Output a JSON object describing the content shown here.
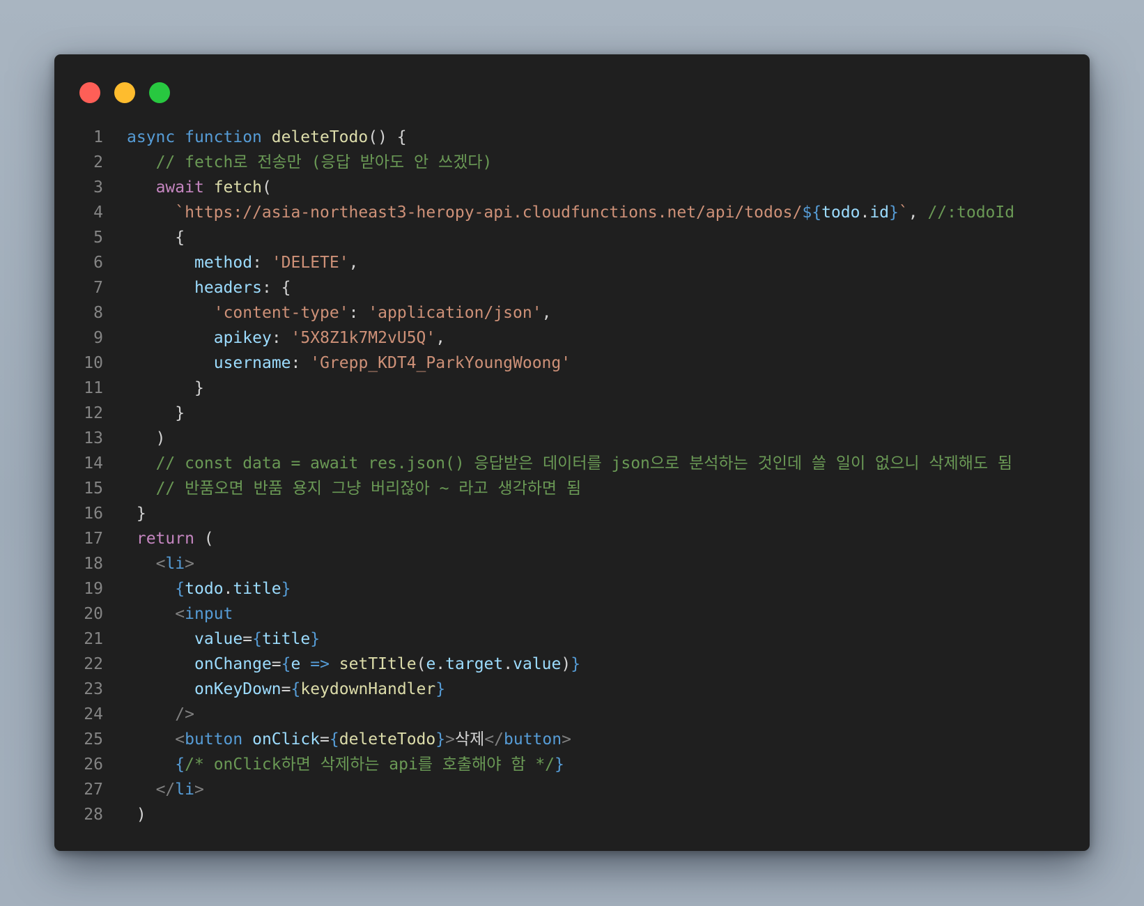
{
  "window": {
    "buttons": {
      "close": "close",
      "minimize": "minimize",
      "zoom": "zoom"
    },
    "colors": {
      "close": "#fe5f57",
      "minimize": "#febc2e",
      "zoom": "#28c840",
      "background": "#1f1f1f"
    }
  },
  "code": {
    "lines": [
      {
        "n": "1",
        "indent": 0,
        "tokens": [
          {
            "t": "async",
            "k": "kw"
          },
          {
            "t": " ",
            "k": "punc"
          },
          {
            "t": "function",
            "k": "kw"
          },
          {
            "t": " ",
            "k": "punc"
          },
          {
            "t": "deleteTodo",
            "k": "fn"
          },
          {
            "t": "() {",
            "k": "punc"
          }
        ]
      },
      {
        "n": "2",
        "indent": 3,
        "tokens": [
          {
            "t": "// fetch로 전송만 (응답 받아도 안 쓰겠다)",
            "k": "cmt"
          }
        ]
      },
      {
        "n": "3",
        "indent": 3,
        "tokens": [
          {
            "t": "await",
            "k": "ctrl"
          },
          {
            "t": " ",
            "k": "punc"
          },
          {
            "t": "fetch",
            "k": "fn"
          },
          {
            "t": "(",
            "k": "punc"
          }
        ]
      },
      {
        "n": "4",
        "indent": 5,
        "tokens": [
          {
            "t": "`https://asia-northeast3-heropy-api.cloudfunctions.net/api/todos/",
            "k": "str"
          },
          {
            "t": "${",
            "k": "kw"
          },
          {
            "t": "todo",
            "k": "var"
          },
          {
            "t": ".",
            "k": "punc"
          },
          {
            "t": "id",
            "k": "var"
          },
          {
            "t": "}",
            "k": "kw"
          },
          {
            "t": "`",
            "k": "str"
          },
          {
            "t": ", ",
            "k": "punc"
          },
          {
            "t": "//:todoId",
            "k": "cmt"
          }
        ]
      },
      {
        "n": "5",
        "indent": 5,
        "tokens": [
          {
            "t": "{",
            "k": "punc"
          }
        ]
      },
      {
        "n": "6",
        "indent": 7,
        "tokens": [
          {
            "t": "method",
            "k": "prop"
          },
          {
            "t": ": ",
            "k": "punc"
          },
          {
            "t": "'DELETE'",
            "k": "str"
          },
          {
            "t": ",",
            "k": "punc"
          }
        ]
      },
      {
        "n": "7",
        "indent": 7,
        "tokens": [
          {
            "t": "headers",
            "k": "prop"
          },
          {
            "t": ": {",
            "k": "punc"
          }
        ]
      },
      {
        "n": "8",
        "indent": 9,
        "tokens": [
          {
            "t": "'content-type'",
            "k": "str"
          },
          {
            "t": ": ",
            "k": "punc"
          },
          {
            "t": "'application/json'",
            "k": "str"
          },
          {
            "t": ",",
            "k": "punc"
          }
        ]
      },
      {
        "n": "9",
        "indent": 9,
        "tokens": [
          {
            "t": "apikey",
            "k": "prop"
          },
          {
            "t": ": ",
            "k": "punc"
          },
          {
            "t": "'5X8Z1k7M2vU5Q'",
            "k": "str"
          },
          {
            "t": ",",
            "k": "punc"
          }
        ]
      },
      {
        "n": "10",
        "indent": 9,
        "tokens": [
          {
            "t": "username",
            "k": "prop"
          },
          {
            "t": ": ",
            "k": "punc"
          },
          {
            "t": "'Grepp_KDT4_ParkYoungWoong'",
            "k": "str"
          }
        ]
      },
      {
        "n": "11",
        "indent": 7,
        "tokens": [
          {
            "t": "}",
            "k": "punc"
          }
        ]
      },
      {
        "n": "12",
        "indent": 5,
        "tokens": [
          {
            "t": "}",
            "k": "punc"
          }
        ]
      },
      {
        "n": "13",
        "indent": 3,
        "tokens": [
          {
            "t": ")",
            "k": "punc"
          }
        ]
      },
      {
        "n": "14",
        "indent": 3,
        "tokens": [
          {
            "t": "// const data = await res.json() 응답받은 데이터를 json으로 분석하는 것인데 쓸 일이 없으니 삭제해도 됨",
            "k": "cmt"
          }
        ]
      },
      {
        "n": "15",
        "indent": 3,
        "tokens": [
          {
            "t": "// 반품오면 반품 용지 그냥 버리잖아 ~ 라고 생각하면 됨",
            "k": "cmt"
          }
        ]
      },
      {
        "n": "16",
        "indent": 1,
        "tokens": [
          {
            "t": "}",
            "k": "punc"
          }
        ]
      },
      {
        "n": "17",
        "indent": 1,
        "tokens": [
          {
            "t": "return",
            "k": "ctrl"
          },
          {
            "t": " (",
            "k": "punc"
          }
        ]
      },
      {
        "n": "18",
        "indent": 3,
        "tokens": [
          {
            "t": "<",
            "k": "brk"
          },
          {
            "t": "li",
            "k": "tag"
          },
          {
            "t": ">",
            "k": "brk"
          }
        ]
      },
      {
        "n": "19",
        "indent": 5,
        "tokens": [
          {
            "t": "{",
            "k": "kw"
          },
          {
            "t": "todo",
            "k": "var"
          },
          {
            "t": ".",
            "k": "punc"
          },
          {
            "t": "title",
            "k": "var"
          },
          {
            "t": "}",
            "k": "kw"
          }
        ]
      },
      {
        "n": "20",
        "indent": 5,
        "tokens": [
          {
            "t": "<",
            "k": "brk"
          },
          {
            "t": "input",
            "k": "tag"
          }
        ]
      },
      {
        "n": "21",
        "indent": 7,
        "tokens": [
          {
            "t": "value",
            "k": "prop"
          },
          {
            "t": "=",
            "k": "punc"
          },
          {
            "t": "{",
            "k": "kw"
          },
          {
            "t": "title",
            "k": "var"
          },
          {
            "t": "}",
            "k": "kw"
          }
        ]
      },
      {
        "n": "22",
        "indent": 7,
        "tokens": [
          {
            "t": "onChange",
            "k": "prop"
          },
          {
            "t": "=",
            "k": "punc"
          },
          {
            "t": "{",
            "k": "kw"
          },
          {
            "t": "e",
            "k": "var"
          },
          {
            "t": " ",
            "k": "punc"
          },
          {
            "t": "=>",
            "k": "kw"
          },
          {
            "t": " ",
            "k": "punc"
          },
          {
            "t": "setTItle",
            "k": "fn"
          },
          {
            "t": "(",
            "k": "punc"
          },
          {
            "t": "e",
            "k": "var"
          },
          {
            "t": ".",
            "k": "punc"
          },
          {
            "t": "target",
            "k": "var"
          },
          {
            "t": ".",
            "k": "punc"
          },
          {
            "t": "value",
            "k": "var"
          },
          {
            "t": ")",
            "k": "punc"
          },
          {
            "t": "}",
            "k": "kw"
          }
        ]
      },
      {
        "n": "23",
        "indent": 7,
        "tokens": [
          {
            "t": "onKeyDown",
            "k": "prop"
          },
          {
            "t": "=",
            "k": "punc"
          },
          {
            "t": "{",
            "k": "kw"
          },
          {
            "t": "keydownHandler",
            "k": "fn"
          },
          {
            "t": "}",
            "k": "kw"
          }
        ]
      },
      {
        "n": "24",
        "indent": 5,
        "tokens": [
          {
            "t": "/>",
            "k": "brk"
          }
        ]
      },
      {
        "n": "25",
        "indent": 5,
        "tokens": [
          {
            "t": "<",
            "k": "brk"
          },
          {
            "t": "button",
            "k": "tag"
          },
          {
            "t": " ",
            "k": "punc"
          },
          {
            "t": "onClick",
            "k": "prop"
          },
          {
            "t": "=",
            "k": "punc"
          },
          {
            "t": "{",
            "k": "kw"
          },
          {
            "t": "deleteTodo",
            "k": "fn"
          },
          {
            "t": "}",
            "k": "kw"
          },
          {
            "t": ">",
            "k": "brk"
          },
          {
            "t": "삭제",
            "k": "text"
          },
          {
            "t": "</",
            "k": "brk"
          },
          {
            "t": "button",
            "k": "tag"
          },
          {
            "t": ">",
            "k": "brk"
          }
        ]
      },
      {
        "n": "26",
        "indent": 5,
        "tokens": [
          {
            "t": "{",
            "k": "kw"
          },
          {
            "t": "/* onClick하면 삭제하는 api를 호출해야 함 */",
            "k": "cmt"
          },
          {
            "t": "}",
            "k": "kw"
          }
        ]
      },
      {
        "n": "27",
        "indent": 3,
        "tokens": [
          {
            "t": "</",
            "k": "brk"
          },
          {
            "t": "li",
            "k": "tag"
          },
          {
            "t": ">",
            "k": "brk"
          }
        ]
      },
      {
        "n": "28",
        "indent": 1,
        "tokens": [
          {
            "t": ")",
            "k": "punc"
          }
        ]
      }
    ]
  }
}
